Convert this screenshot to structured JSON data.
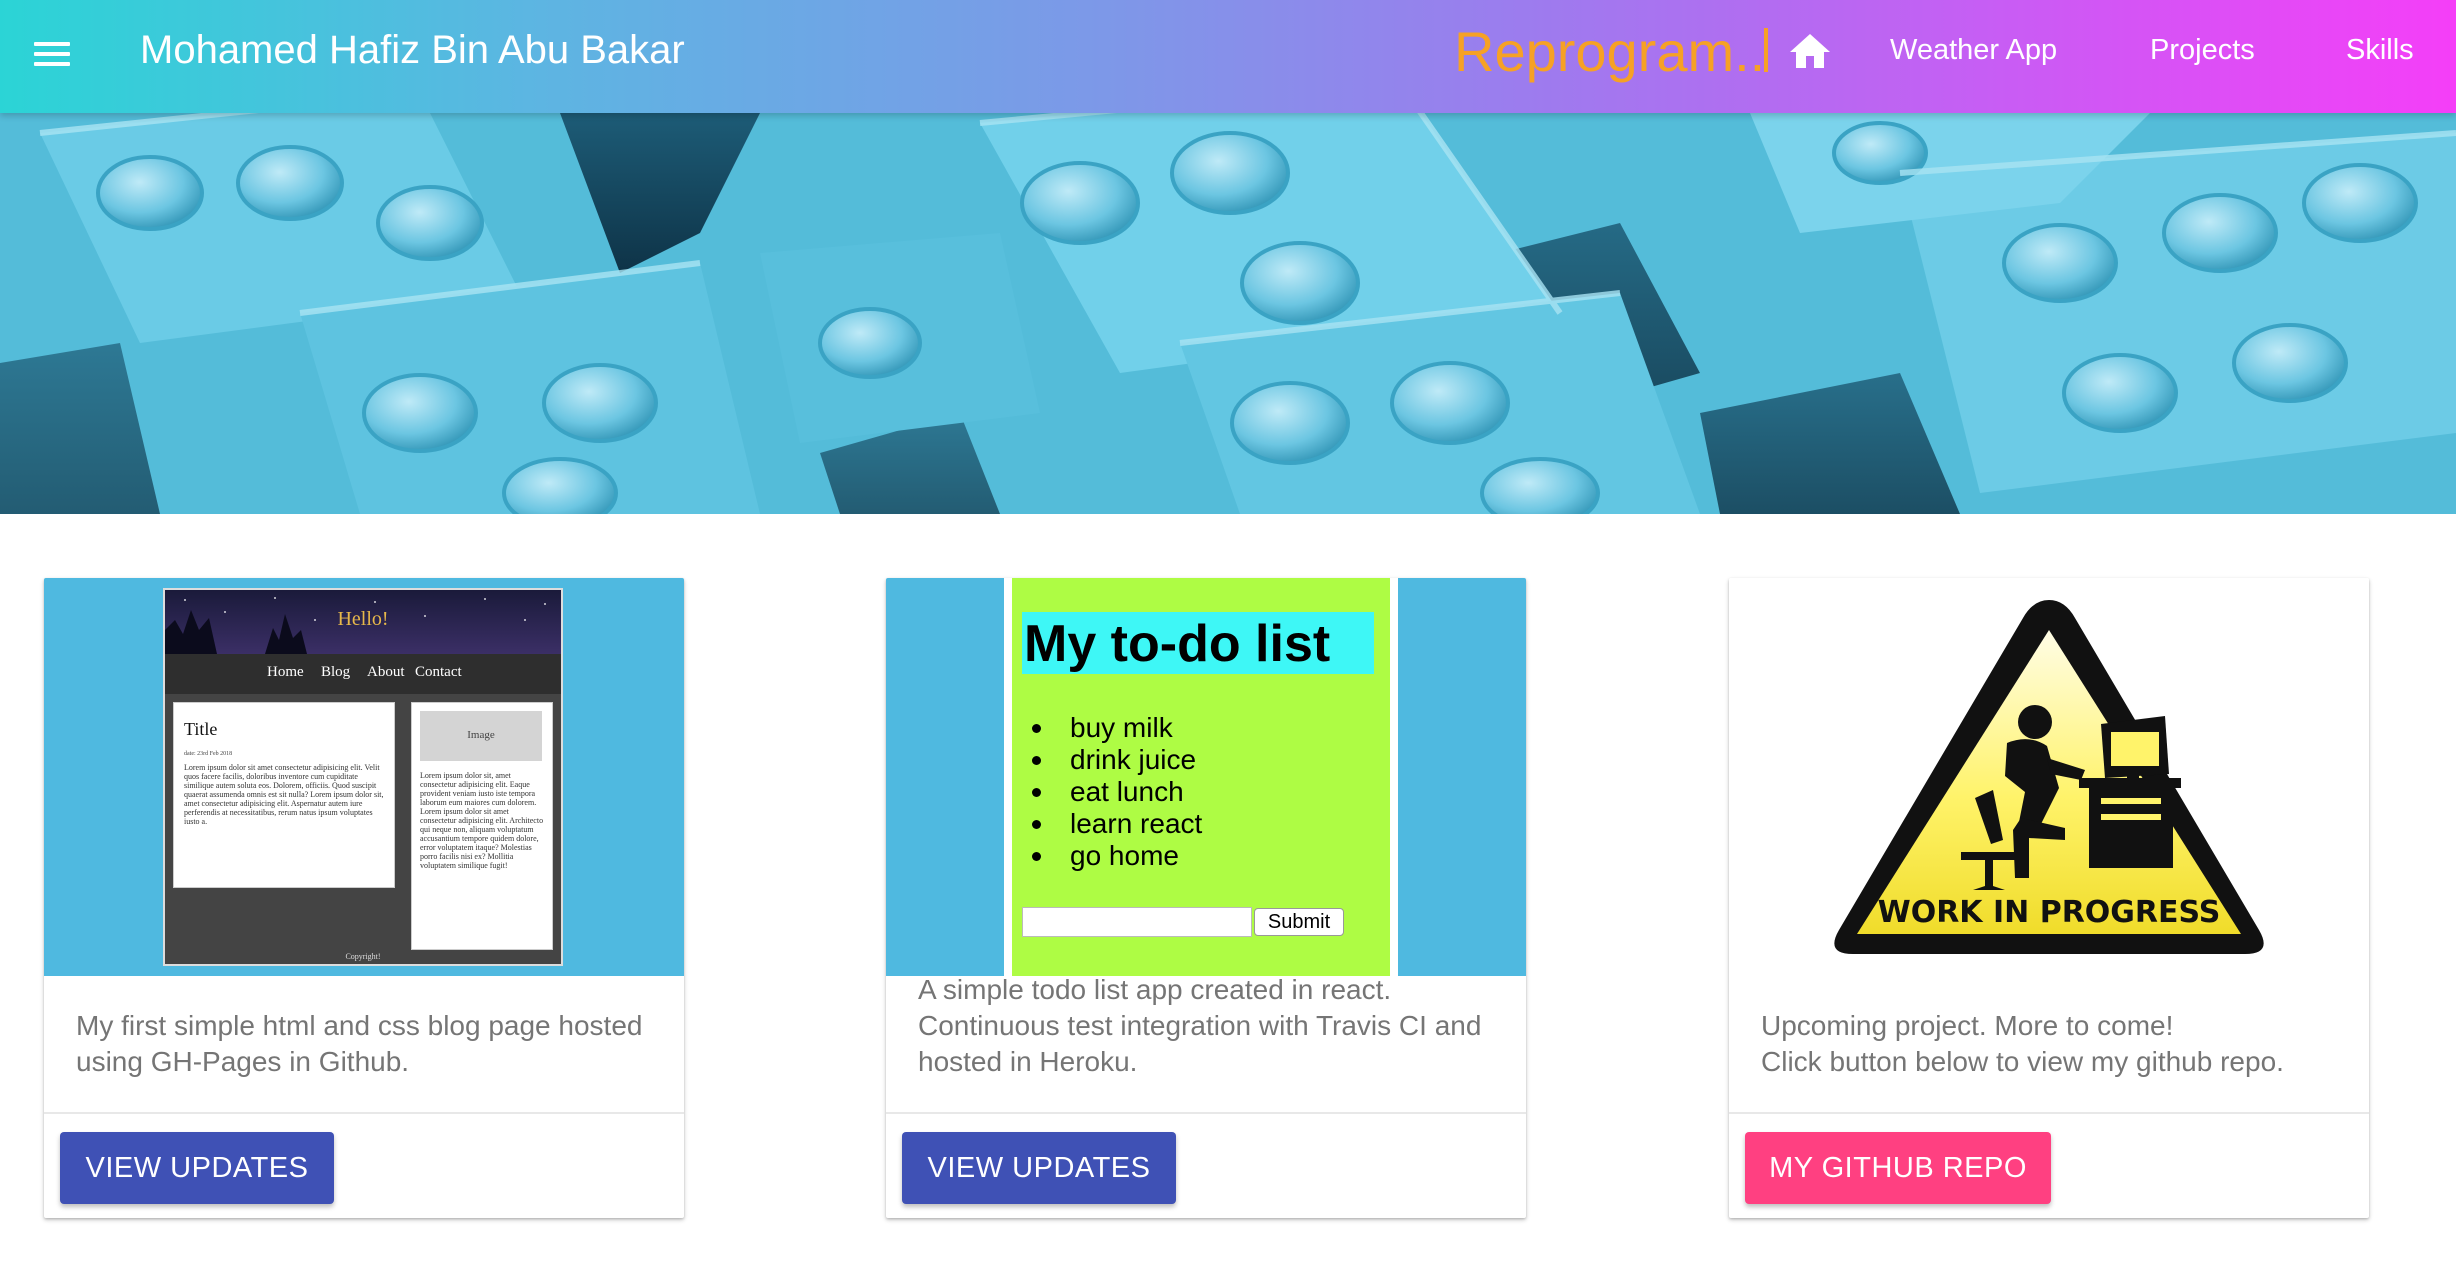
{
  "header": {
    "title": "Mohamed Hafiz Bin Abu Bakar",
    "typing_text": "Reprogram..",
    "nav": [
      "Weather App",
      "Projects",
      "Skills"
    ],
    "colors": {
      "gradient_start": "#2bd4d6",
      "gradient_end": "#f53ef8",
      "typing": "#f6a125"
    }
  },
  "cards": [
    {
      "image": {
        "hello": "Hello!",
        "nav": [
          "Home",
          "Blog",
          "About",
          "Contact"
        ],
        "post_title": "Title",
        "post_date": "date: 23rd Feb 2018",
        "post_body": "Lorem ipsum dolor sit amet consectetur adipisicing elit. Velit quos facere facilis, doloribus inventore cum cupiditate similique autem soluta eos. Dolorem, officiis. Quod suscipit quaerat assumenda omnis est sit nulla? Lorem ipsum dolor sit, amet consectetur adipisicing elit. Aspernatur autem iure perferendis at necessitatibus, rerum natus ipsum voluptates iusto a.",
        "side_image_label": "Image",
        "side_body": "Lorem ipsum dolor sit, amet consectetur adipisicing elit. Eaque provident veniam iusto iste tempora laborum eum maiores cum dolorem. Lorem ipsum dolor sit amet consectetur adipisicing elit. Architecto qui neque non, aliquam voluptatum accusantium tempore quidem dolore, error voluptatem itaque? Molestias porro facilis nisi ex? Mollitia voluptatem similique fugit!",
        "copyright": "Copyright!"
      },
      "text_lines": [
        "My first simple html and css blog page hosted",
        "using GH-Pages in Github."
      ],
      "button": "VIEW UPDATES"
    },
    {
      "image": {
        "title": "My to-do list",
        "items": [
          "buy milk",
          "drink juice",
          "eat lunch",
          "learn react",
          "go home"
        ],
        "submit": "Submit"
      },
      "text_lines": [
        "A simple todo list app created in react.",
        "Continuous test integration with Travis CI and",
        "hosted in Heroku."
      ],
      "button": "VIEW UPDATES"
    },
    {
      "image": {
        "sign_text": "WORK IN PROGRESS"
      },
      "text_lines": [
        "Upcoming project. More to come!",
        "Click button below to view my github repo."
      ],
      "button": "MY GITHUB REPO"
    }
  ]
}
